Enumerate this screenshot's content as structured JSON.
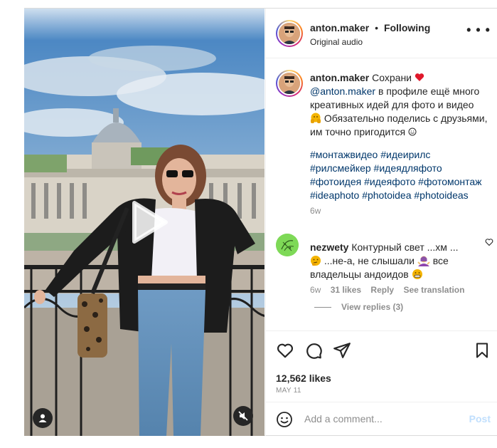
{
  "header": {
    "username": "anton.maker",
    "separator": "•",
    "follow_status": "Following",
    "audio": "Original audio",
    "more_icon": "more-horizontal-icon"
  },
  "caption": {
    "username": "anton.maker",
    "text_1": "Сохрани",
    "mention": "@anton.maker",
    "text_2": "в профиле ещё много креативных идей для фото и видео",
    "text_3": "Обязательно поделись с друзьями, им точно пригодится",
    "hashtags": [
      "#монтажвидео",
      "#идеирилс",
      "#рилсмейкер",
      "#идеядляфото",
      "#фотоидея",
      "#идеяфото",
      "#фотомонтаж",
      "#ideaphoto",
      "#photoidea",
      "#photoideas"
    ],
    "time": "6w"
  },
  "comment": {
    "username": "nezwety",
    "text_1": "Контурный свет ...хм ...",
    "text_2": "...не-а, не слышали",
    "text_3": "все владельцы андоидов",
    "time": "6w",
    "likes": "31 likes",
    "reply": "Reply",
    "translation": "See translation",
    "view_replies": "View replies (3)"
  },
  "actions": {
    "like_icon": "heart-icon",
    "comment_icon": "comment-icon",
    "share_icon": "share-icon",
    "save_icon": "bookmark-icon"
  },
  "likes": "12,562 likes",
  "date": "MAY 11",
  "add_comment": {
    "placeholder": "Add a comment...",
    "post_label": "Post",
    "emoji_icon": "emoji-icon"
  },
  "colors": {
    "link": "#00376b",
    "muted": "#8e8e8e",
    "post_disabled": "#c0dffd",
    "heart_red": "#ed4956"
  }
}
